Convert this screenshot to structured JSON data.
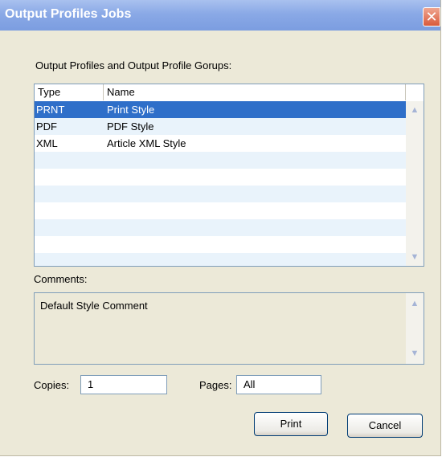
{
  "window": {
    "title": "Output Profiles Jobs",
    "close_glyph": "✕"
  },
  "profiles_label": "Output Profiles and Output Profile Gorups:",
  "list": {
    "columns": [
      "Type",
      "Name"
    ],
    "rows": [
      {
        "type": "PRNT",
        "name": "Print Style",
        "selected": true
      },
      {
        "type": "PDF",
        "name": "PDF Style",
        "selected": false
      },
      {
        "type": "XML",
        "name": "Article XML Style",
        "selected": false
      }
    ]
  },
  "comments_label": "Comments:",
  "comments_text": "Default Style Comment",
  "copies": {
    "label": "Copies:",
    "value": "1"
  },
  "pages": {
    "label": "Pages:",
    "value": "All"
  },
  "buttons": {
    "print": "Print",
    "cancel": "Cancel"
  },
  "icons": {
    "scroll_up": "▲",
    "scroll_down": "▼"
  },
  "colors": {
    "selection": "#2f6fc9",
    "title_bar": "#8aa9e6",
    "close": "#d95a3c"
  }
}
